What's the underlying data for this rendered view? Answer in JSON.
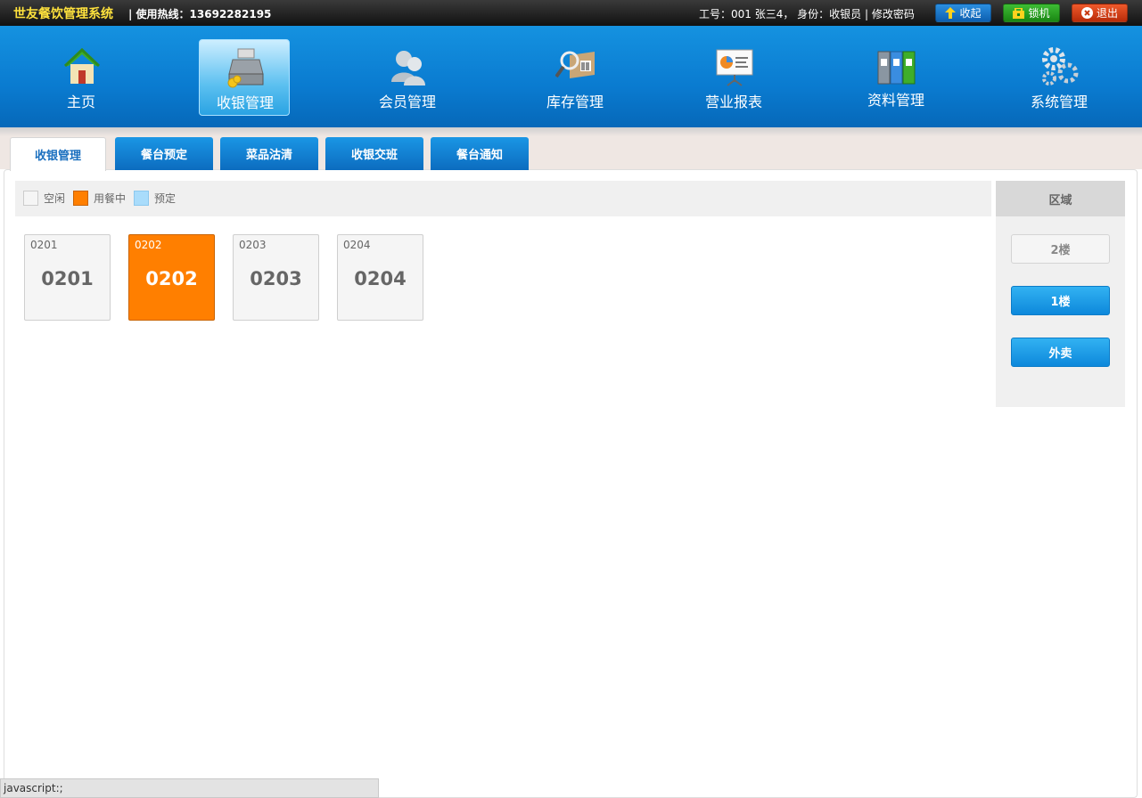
{
  "topbar": {
    "system_name": "世友餐饮管理系统",
    "hotline": "| 使用热线：13692282195",
    "user_info": "工号：001 张三4， 身份：收银员 |   修改密码",
    "buttons": [
      {
        "label": "收起",
        "icon": "up-arrow-icon"
      },
      {
        "label": "锁机",
        "icon": "lock-icon"
      },
      {
        "label": "退出",
        "icon": "close-icon"
      }
    ]
  },
  "nav": {
    "items": [
      {
        "label": "主页",
        "icon": "home-icon"
      },
      {
        "label": "收银管理",
        "icon": "cash-register-icon",
        "active": true
      },
      {
        "label": "会员管理",
        "icon": "members-icon"
      },
      {
        "label": "库存管理",
        "icon": "inventory-icon"
      },
      {
        "label": "营业报表",
        "icon": "report-icon"
      },
      {
        "label": "资料管理",
        "icon": "binders-icon"
      },
      {
        "label": "系统管理",
        "icon": "gears-icon"
      }
    ]
  },
  "tabs": [
    {
      "label": "收银管理",
      "active": true
    },
    {
      "label": "餐台预定"
    },
    {
      "label": "菜品沽清"
    },
    {
      "label": "收银交班"
    },
    {
      "label": "餐台通知"
    }
  ],
  "legend": [
    {
      "label": "空闲",
      "color": "#f5f5f5"
    },
    {
      "label": "用餐中",
      "color": "#ff7f00"
    },
    {
      "label": "预定",
      "color": "#a9dcfb"
    }
  ],
  "tables": [
    {
      "code": "0201",
      "name": "0201",
      "status": "free"
    },
    {
      "code": "0202",
      "name": "0202",
      "status": "busy"
    },
    {
      "code": "0203",
      "name": "0203",
      "status": "free"
    },
    {
      "code": "0204",
      "name": "0204",
      "status": "free"
    }
  ],
  "area": {
    "title": "区域",
    "buttons": [
      {
        "label": "2楼",
        "style": "gray"
      },
      {
        "label": "1楼",
        "style": "blue"
      },
      {
        "label": "外卖",
        "style": "blue"
      }
    ]
  },
  "statusbar": {
    "text": "javascript:;"
  }
}
